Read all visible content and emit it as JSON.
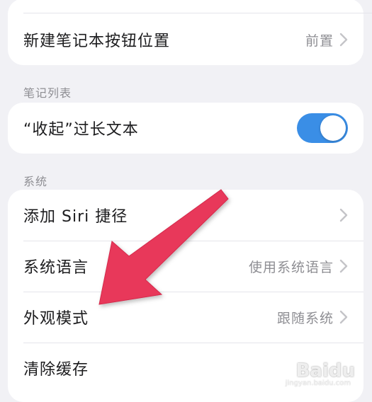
{
  "top_card": {
    "row_new_notebook": {
      "label": "新建笔记本按钮位置",
      "value": "前置"
    }
  },
  "notes_list": {
    "header": "笔记列表",
    "row_collapse": {
      "label": "“收起”过长文本",
      "toggle_on": true
    }
  },
  "system": {
    "header": "系统",
    "rows": [
      {
        "label": "添加 Siri 捷径",
        "value": ""
      },
      {
        "label": "系统语言",
        "value": "使用系统语言"
      },
      {
        "label": "外观模式",
        "value": "跟随系统"
      },
      {
        "label": "清除缓存",
        "value": ""
      }
    ]
  },
  "icons": {
    "chevron": "chevron-right-icon",
    "annotation": "red-arrow-icon",
    "watermark": "baidu-watermark"
  },
  "colors": {
    "background": "#f1f1f5",
    "toggle_on": "#3a8ee6",
    "chevron": "#c4c4c8",
    "arrow": "#e8395a"
  },
  "watermark": {
    "text": "Baidu",
    "sub": "jingyan.baidu.com"
  }
}
